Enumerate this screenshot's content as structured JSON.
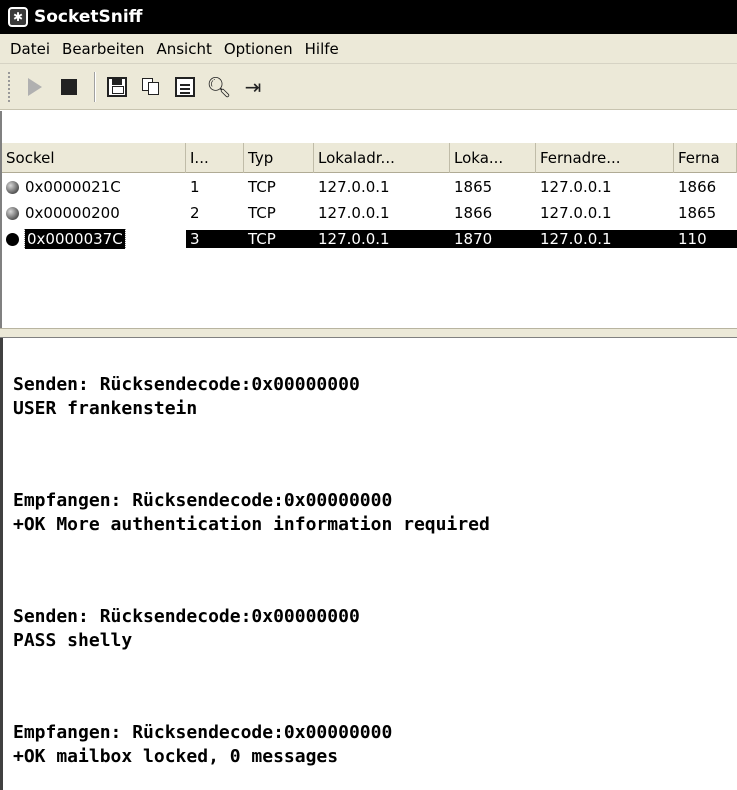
{
  "window": {
    "title": "SocketSniff"
  },
  "menu": [
    "Datei",
    "Bearbeiten",
    "Ansicht",
    "Optionen",
    "Hilfe"
  ],
  "toolbar": {
    "buttons": [
      "play-icon",
      "stop-icon",
      "save-icon",
      "copy-icon",
      "properties-icon",
      "find-icon",
      "exit-icon"
    ]
  },
  "table": {
    "columns": [
      "Sockel",
      "I...",
      "Typ",
      "Lokaladr...",
      "Loka...",
      "Fernadre...",
      "Ferna"
    ],
    "rows": [
      {
        "socket": "0x0000021C",
        "id": "1",
        "type": "TCP",
        "local_addr": "127.0.0.1",
        "local_port": "1865",
        "remote_addr": "127.0.0.1",
        "remote_port": "1866"
      },
      {
        "socket": "0x00000200",
        "id": "2",
        "type": "TCP",
        "local_addr": "127.0.0.1",
        "local_port": "1866",
        "remote_addr": "127.0.0.1",
        "remote_port": "1865"
      },
      {
        "socket": "0x0000037C",
        "id": "3",
        "type": "TCP",
        "local_addr": "127.0.0.1",
        "local_port": "1870",
        "remote_addr": "127.0.0.1",
        "remote_port": "110",
        "selected": true
      }
    ]
  },
  "log": [
    "Senden: Rücksendecode:0x00000000",
    "USER frankenstein",
    "Empfangen: Rücksendecode:0x00000000",
    "+OK More authentication information required",
    "Senden: Rücksendecode:0x00000000",
    "PASS shelly",
    "Empfangen: Rücksendecode:0x00000000",
    "+OK mailbox locked, 0 messages"
  ]
}
